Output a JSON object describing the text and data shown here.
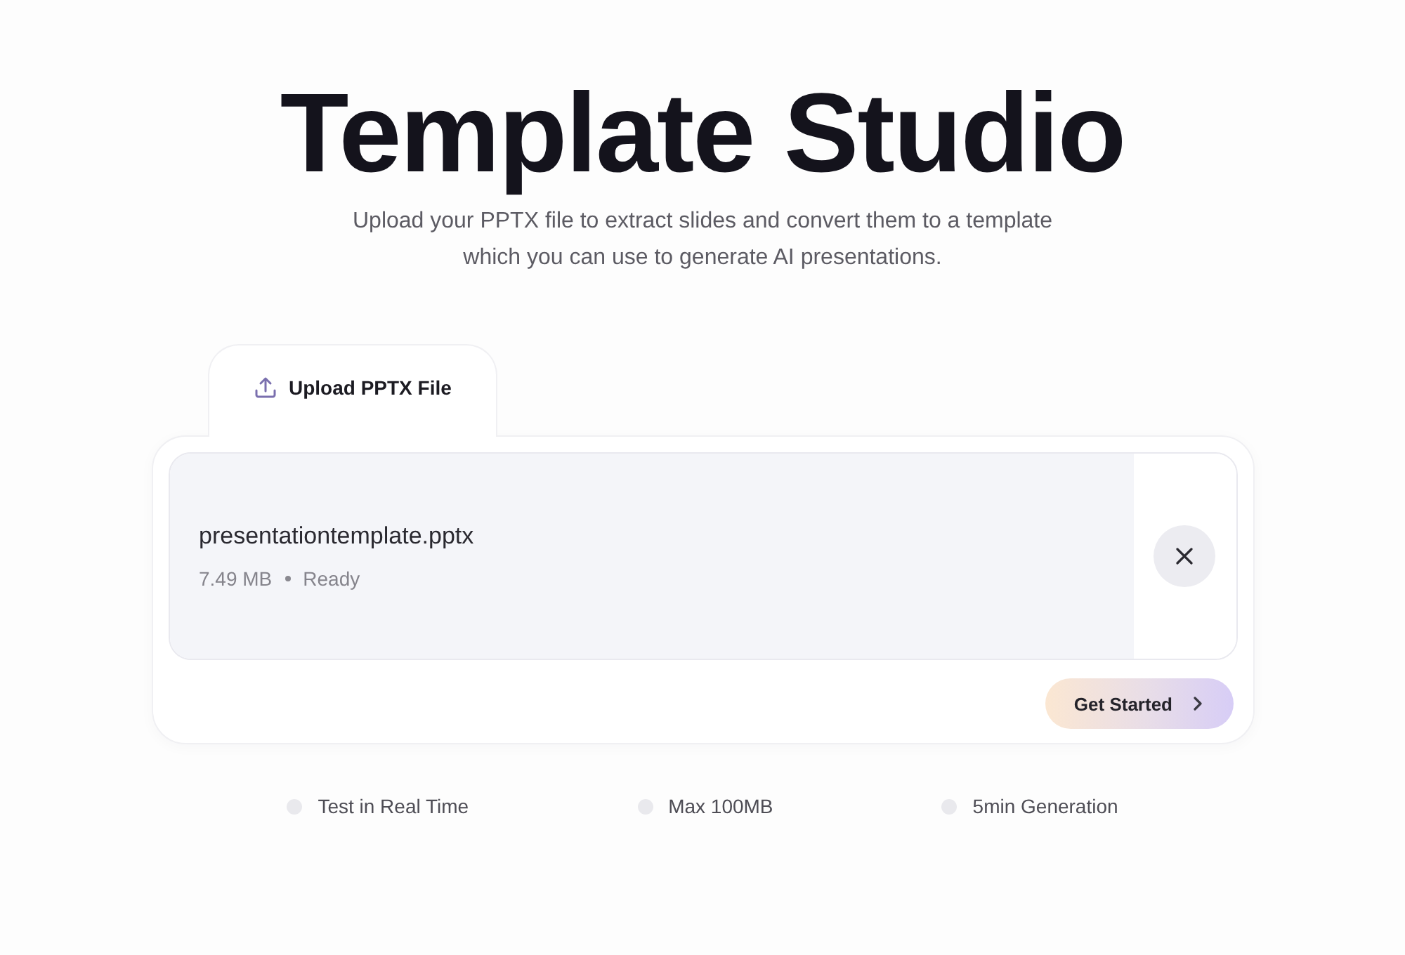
{
  "header": {
    "title": "Template Studio",
    "subtitle_lines": [
      "Upload your PPTX file to extract slides and convert them to a template",
      "which you can use to generate AI presentations."
    ]
  },
  "tabs": [
    {
      "label": "Upload PPTX File",
      "selected": true
    }
  ],
  "file": {
    "name": "presentationtemplate.pptx",
    "size": "7.49 MB",
    "status": "Ready"
  },
  "action": {
    "label": "Get Started"
  },
  "features": [
    {
      "label": "Test in Real Time"
    },
    {
      "label": "Max 100MB"
    },
    {
      "label": "5min Generation"
    }
  ]
}
